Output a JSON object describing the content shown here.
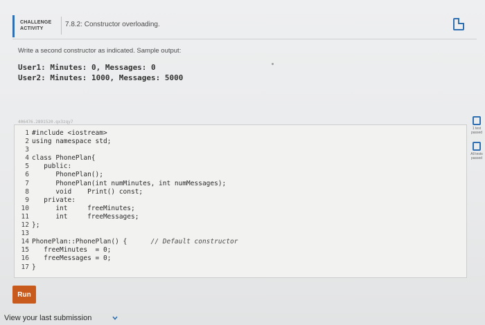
{
  "header": {
    "badge_line1": "CHALLENGE",
    "badge_line2": "ACTIVITY",
    "title": "7.8.2: Constructor overloading."
  },
  "prompt": "Write a second constructor as indicated. Sample output:",
  "sample_output": [
    "User1: Minutes: 0, Messages: 0",
    "User2: Minutes: 1000, Messages: 5000"
  ],
  "code_id": "406476.2891520.qx3zqy7",
  "code_lines": [
    {
      "n": "1",
      "text": "#include <iostream>"
    },
    {
      "n": "2",
      "text": "using namespace std;"
    },
    {
      "n": "3",
      "text": ""
    },
    {
      "n": "4",
      "text": "class PhonePlan{"
    },
    {
      "n": "5",
      "text": "   public:"
    },
    {
      "n": "6",
      "text": "      PhonePlan();"
    },
    {
      "n": "7",
      "text": "      PhonePlan(int numMinutes, int numMessages);"
    },
    {
      "n": "8",
      "text": "      void    Print() const;"
    },
    {
      "n": "9",
      "text": "   private:"
    },
    {
      "n": "10",
      "text": "      int     freeMinutes;"
    },
    {
      "n": "11",
      "text": "      int     freeMessages;"
    },
    {
      "n": "12",
      "text": "};"
    },
    {
      "n": "13",
      "text": ""
    },
    {
      "n": "14",
      "text": "PhonePlan::PhonePlan() {      ",
      "comment": "// Default constructor"
    },
    {
      "n": "15",
      "text": "   freeMinutes  = 0;"
    },
    {
      "n": "16",
      "text": "   freeMessages = 0;"
    },
    {
      "n": "17",
      "text": "}"
    }
  ],
  "side_tests": [
    {
      "label": "1 test passed"
    },
    {
      "label": "All tests passed"
    }
  ],
  "run_label": "Run",
  "view_last_label": "View your last submission",
  "colors": {
    "accent": "#2f6fb1",
    "run_button": "#c85a1e"
  }
}
